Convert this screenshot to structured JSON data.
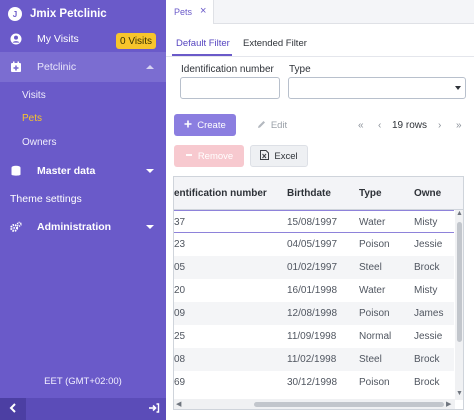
{
  "app": {
    "title": "Jmix Petclinic",
    "logo_letter": "J"
  },
  "sidebar": {
    "my_visits": {
      "label": "My Visits",
      "badge": "0 Visits",
      "icon": "user-circle-icon"
    },
    "petclinic": {
      "label": "Petclinic",
      "icon": "clinic-icon",
      "items": [
        {
          "label": "Visits",
          "active": false
        },
        {
          "label": "Pets",
          "active": true
        },
        {
          "label": "Owners",
          "active": false
        }
      ]
    },
    "master_data": {
      "label": "Master data",
      "icon": "database-icon"
    },
    "theme_settings": {
      "label": "Theme settings"
    },
    "administration": {
      "label": "Administration",
      "icon": "gears-icon"
    },
    "timezone": "EET (GMT+02:00)"
  },
  "tabs": [
    {
      "label": "Pets",
      "close": "×"
    }
  ],
  "filter": {
    "tabs": [
      "Default Filter",
      "Extended Filter"
    ],
    "fields": [
      {
        "label": "Identification number",
        "value": ""
      },
      {
        "label": "Type",
        "value": ""
      }
    ]
  },
  "toolbar": {
    "create": "Create",
    "edit": "Edit",
    "remove": "Remove",
    "excel": "Excel",
    "rows": "19 rows",
    "first": "«",
    "prev": "‹",
    "next": "›",
    "last": "»"
  },
  "table": {
    "columns": [
      "entification number",
      "Birthdate",
      "Type",
      "Owne"
    ],
    "rows": [
      [
        "37",
        "15/08/1997",
        "Water",
        "Misty"
      ],
      [
        "23",
        "04/05/1997",
        "Poison",
        "Jessie"
      ],
      [
        "05",
        "01/02/1997",
        "Steel",
        "Brock"
      ],
      [
        "20",
        "16/01/1998",
        "Water",
        "Misty"
      ],
      [
        "09",
        "12/08/1998",
        "Poison",
        "James"
      ],
      [
        "25",
        "11/09/1998",
        "Normal",
        "Jessie"
      ],
      [
        "08",
        "11/02/1998",
        "Steel",
        "Brock"
      ],
      [
        "69",
        "30/12/1998",
        "Poison",
        "Brock"
      ]
    ]
  },
  "colors": {
    "sidebar_bg": "#6a5ac9",
    "accent": "#6a5ac9",
    "badge": "#f7c52b",
    "remove_disabled": "#f7c9cf"
  }
}
